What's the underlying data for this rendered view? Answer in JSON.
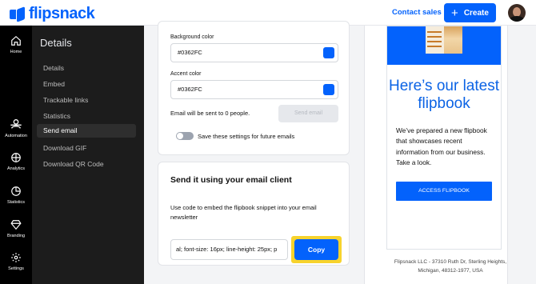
{
  "app": {
    "logo_text": "flipsnack",
    "brand_color": "#0362FC"
  },
  "header": {
    "contact_label": "Contact sales",
    "create_label": "Create",
    "create_icon": "plus-icon"
  },
  "rail": {
    "items": [
      {
        "label": "Home",
        "icon": "home-icon"
      },
      {
        "label": "Automation",
        "icon": "automation-icon"
      },
      {
        "label": "Analytics",
        "icon": "analytics-icon"
      },
      {
        "label": "Statistics",
        "icon": "statistics-icon"
      },
      {
        "label": "Branding",
        "icon": "diamond-icon"
      },
      {
        "label": "Settings",
        "icon": "gear-icon"
      }
    ]
  },
  "details": {
    "title": "Details",
    "items": [
      {
        "label": "Details"
      },
      {
        "label": "Embed"
      },
      {
        "label": "Trackable links"
      },
      {
        "label": "Statistics"
      },
      {
        "label": "Send email",
        "active": true
      },
      {
        "label": "Download GIF"
      },
      {
        "label": "Download QR Code"
      }
    ]
  },
  "email_form": {
    "background_color_label": "Background color",
    "background_color_value": "#0362FC",
    "accent_color_label": "Accent color",
    "accent_color_value": "#0362FC",
    "recipients_note": "Email will be sent to 0 people.",
    "send_label": "Send email",
    "save_settings_label": "Save these settings for future emails"
  },
  "client_card": {
    "title": "Send it using your email client",
    "description": "Use code to embed the flipbook snippet into your email newsletter",
    "code_value": "al; font-size: 16px; line-height: 25px; p",
    "copy_label": "Copy"
  },
  "preview": {
    "headline": "Here’s our latest flipbook",
    "body": "We’ve prepared a new flipbook that showcases recent information from our business. Take a look.",
    "cta_label": "ACCESS FLIPBOOK",
    "footer": "Flipsnack LLC - 37310 Ruth Dr, Sterling Heights, Michigan, 48312-1977, USA"
  }
}
